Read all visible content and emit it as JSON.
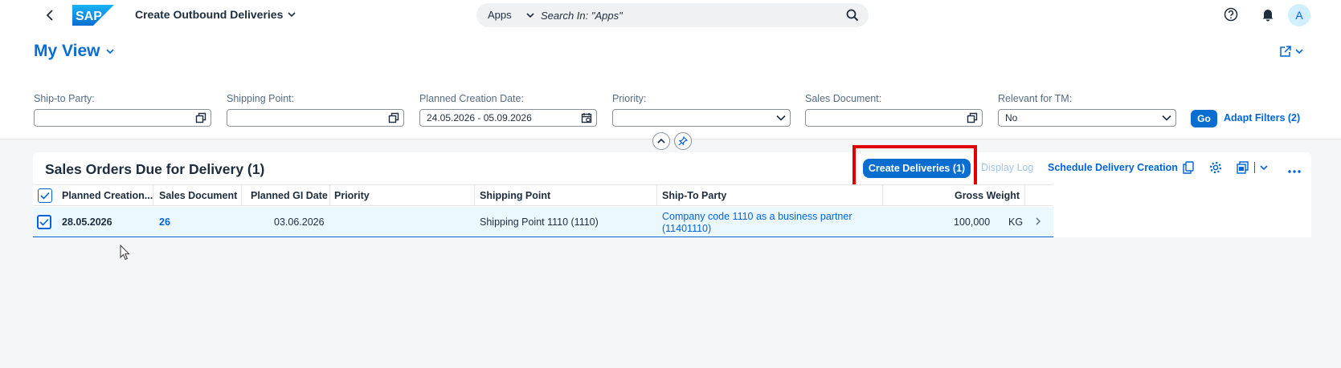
{
  "shell": {
    "app_title": "Create Outbound Deliveries",
    "search_scope": "Apps",
    "search_placeholder": "Search In: \"Apps\"",
    "avatar_initial": "A"
  },
  "header": {
    "variant_name": "My View"
  },
  "filters": [
    {
      "label": "Ship-to Party:",
      "value": "",
      "icon": "value-help-icon"
    },
    {
      "label": "Shipping Point:",
      "value": "",
      "icon": "value-help-icon"
    },
    {
      "label": "Planned Creation Date:",
      "value": "24.05.2026 - 05.09.2026",
      "icon": "calendar-icon"
    },
    {
      "label": "Priority:",
      "value": "",
      "icon": "chevron-down-icon"
    },
    {
      "label": "Sales Document:",
      "value": "",
      "icon": "value-help-icon"
    },
    {
      "label": "Relevant for TM:",
      "value": "No",
      "icon": "chevron-down-icon"
    }
  ],
  "filterbar": {
    "go_label": "Go",
    "adapt_label": "Adapt Filters (2)"
  },
  "table": {
    "title": "Sales Orders Due for Delivery (1)",
    "create_label": "Create Deliveries (1)",
    "display_log_label": "Display Log",
    "schedule_label": "Schedule Delivery Creation",
    "columns": [
      "Planned Creation...",
      "Sales Document",
      "Planned GI Date",
      "Priority",
      "Shipping Point",
      "Ship-To Party",
      "Gross Weight"
    ],
    "rows": [
      {
        "planned_creation": "28.05.2026",
        "sales_document": "26",
        "planned_gi_date": "03.06.2026",
        "priority": "",
        "shipping_point": "Shipping Point 1110 (1110)",
        "ship_to_line1": "Company code 1110 as a business partner",
        "ship_to_line2": "(11401110)",
        "gross_weight": "100,000",
        "unit": "KG"
      }
    ]
  },
  "colors": {
    "brand": "#0a6ed1",
    "link": "#0064d9",
    "highlight": "#e00000",
    "selected_row": "#ebf8ff"
  }
}
